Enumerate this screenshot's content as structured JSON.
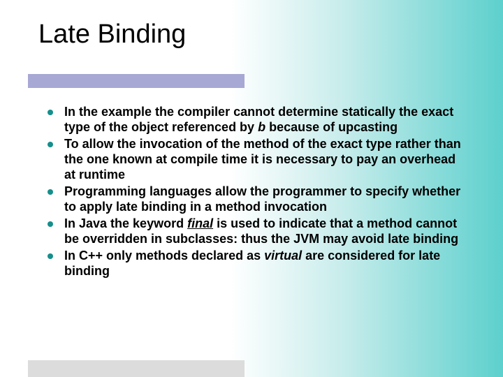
{
  "title": "Late Binding",
  "bullets": [
    {
      "prefix": "In the example the compiler cannot determine statically the exact type of the object referenced by ",
      "em": "b",
      "suffix": " because of upcasting"
    },
    {
      "prefix": "To allow the invocation of the method of the exact type rather than the one known at compile time it is necessary to pay an overhead at runtime",
      "em": "",
      "suffix": ""
    },
    {
      "prefix": "Programming languages allow the programmer to specify whether to apply late binding in a method invocation",
      "em": "",
      "suffix": ""
    },
    {
      "prefix": "In Java the keyword ",
      "em_ub": "final",
      "suffix": " is used to indicate that a method cannot be overridden in subclasses: thus the JVM may avoid late binding"
    },
    {
      "prefix": "In C++ only methods declared as ",
      "em": "virtual",
      "suffix": " are considered for late binding"
    }
  ]
}
